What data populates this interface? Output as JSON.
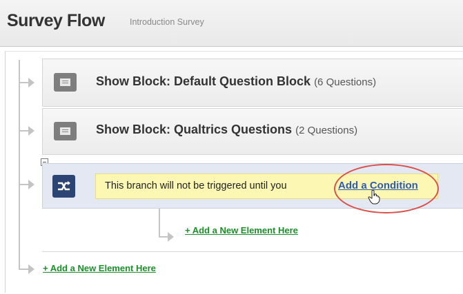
{
  "header": {
    "title": "Survey Flow",
    "subtitle": "Introduction Survey"
  },
  "flow": {
    "blocks": [
      {
        "label": "Show Block: Default Question Block",
        "count": "(6 Questions)",
        "icon": "block-icon"
      },
      {
        "label": "Show Block: Qualtrics Questions",
        "count": "(2 Questions)",
        "icon": "block-icon"
      }
    ],
    "branch": {
      "icon": "branch-icon",
      "message": "This branch will not be triggered until you",
      "link": "Add a Condition",
      "add_element": "+ Add a New Element Here"
    },
    "add_element": "+ Add a New Element Here"
  },
  "colors": {
    "branch_bg": "#e4e8f2",
    "message_bg": "#fcf8b4",
    "link": "#2f5bb0",
    "add_link": "#1c8f2b",
    "highlight": "#d9504a",
    "branch_icon_bg": "#2b4474"
  }
}
